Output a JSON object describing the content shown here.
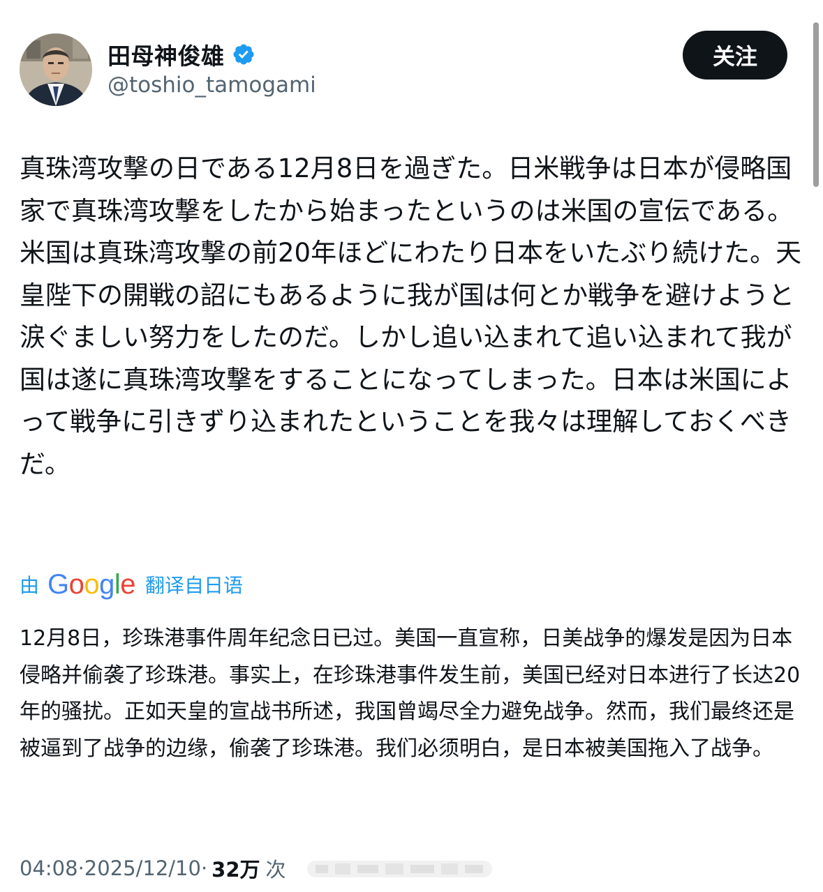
{
  "user": {
    "display_name": "田母神俊雄",
    "handle": "@toshio_tamogami",
    "verified": true,
    "avatar": "avatar-photo"
  },
  "follow_button": {
    "label": "关注"
  },
  "tweet": {
    "text": "真珠湾攻撃の日である12月8日を過ぎた。日米戦争は日本が侵略国家で真珠湾攻撃をしたから始まったというのは米国の宣伝である。米国は真珠湾攻撃の前20年ほどにわたり日本をいたぶり続けた。天皇陛下の開戦の詔にもあるように我が国は何とか戦争を避けようと涙ぐましい努力をしたのだ。しかし追い込まれて追い込まれて我が国は遂に真珠湾攻撃をすることになってしまった。日本は米国によって戦争に引きずり込まれたということを我々は理解しておくべきだ。"
  },
  "translation": {
    "by_label": "由",
    "provider": "Google",
    "source_label": "翻译自日语",
    "text": "12月8日，珍珠港事件周年纪念日已过。美国一直宣称，日美战争的爆发是因为日本侵略并偷袭了珍珠港。事实上，在珍珠港事件发生前，美国已经对日本进行了长达20年的骚扰。正如天皇的宣战书所述，我国曾竭尽全力避免战争。然而，我们最终还是被逼到了战争的边缘，偷袭了珍珠港。我们必须明白，是日本被美国拖入了战争。"
  },
  "meta": {
    "time": "04:08",
    "separator": " · ",
    "date": "2025/12/10",
    "views": "32万",
    "views_label": "次"
  },
  "colors": {
    "link": "#1d9bf0",
    "verified": "#1d9bf0",
    "secondary_text": "#536471",
    "primary_text": "#0f1419",
    "button_bg": "#0f1419"
  }
}
